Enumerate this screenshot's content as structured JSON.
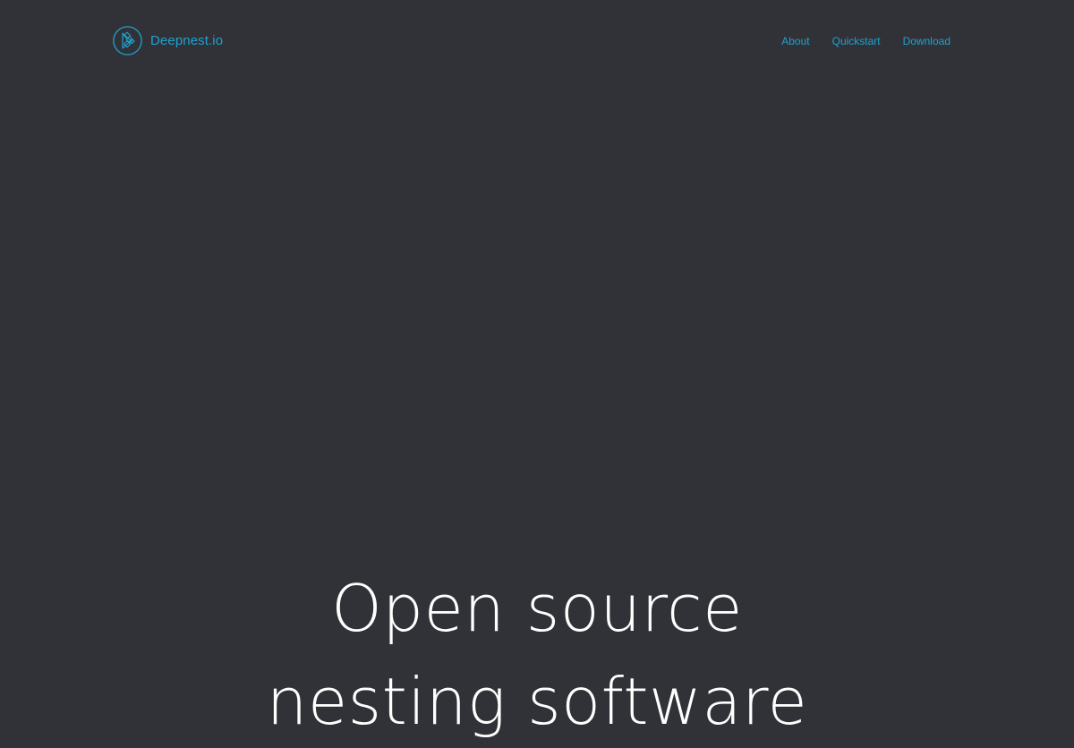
{
  "colors": {
    "background": "#313237",
    "accent": "#1fa1cf",
    "heading": "#ffffff"
  },
  "header": {
    "brand": {
      "icon": "deepnest-logo-icon",
      "name": "Deepnest.io"
    },
    "nav": [
      {
        "label": "About"
      },
      {
        "label": "Quickstart"
      },
      {
        "label": "Download"
      }
    ]
  },
  "hero": {
    "line1": "Open source",
    "line2": "nesting software"
  }
}
